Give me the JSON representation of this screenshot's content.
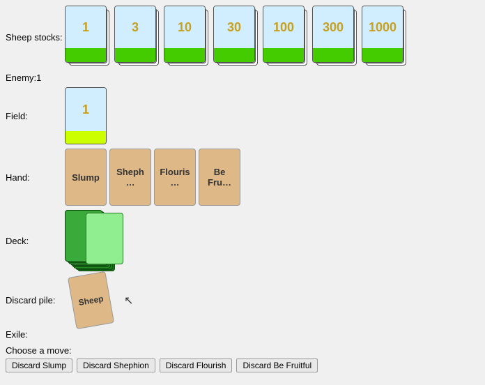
{
  "sheepStocks": {
    "label": "Sheep stocks:",
    "cards": [
      {
        "value": "1"
      },
      {
        "value": "3"
      },
      {
        "value": "10"
      },
      {
        "value": "30"
      },
      {
        "value": "100"
      },
      {
        "value": "300"
      },
      {
        "value": "1000"
      }
    ]
  },
  "enemy": {
    "label": "Enemy:",
    "value": "1"
  },
  "field": {
    "label": "Field:",
    "value": "1"
  },
  "hand": {
    "label": "Hand:",
    "cards": [
      {
        "name": "Slump"
      },
      {
        "name": "Sheph…"
      },
      {
        "name": "Flouris…"
      },
      {
        "name": "Be Fru…"
      }
    ]
  },
  "deck": {
    "label": "Deck:"
  },
  "discardPile": {
    "label": "Discard pile:",
    "topCard": "Sheep"
  },
  "exile": {
    "label": "Exile:"
  },
  "chooseMove": {
    "label": "Choose a move:"
  },
  "buttons": [
    {
      "label": "Discard Slump",
      "name": "discard-slump-button"
    },
    {
      "label": "Discard Shephion",
      "name": "discard-shephion-button"
    },
    {
      "label": "Discard Flourish",
      "name": "discard-flourish-button"
    },
    {
      "label": "Discard Be Fruitful",
      "name": "discard-be-fruitful-button"
    }
  ]
}
